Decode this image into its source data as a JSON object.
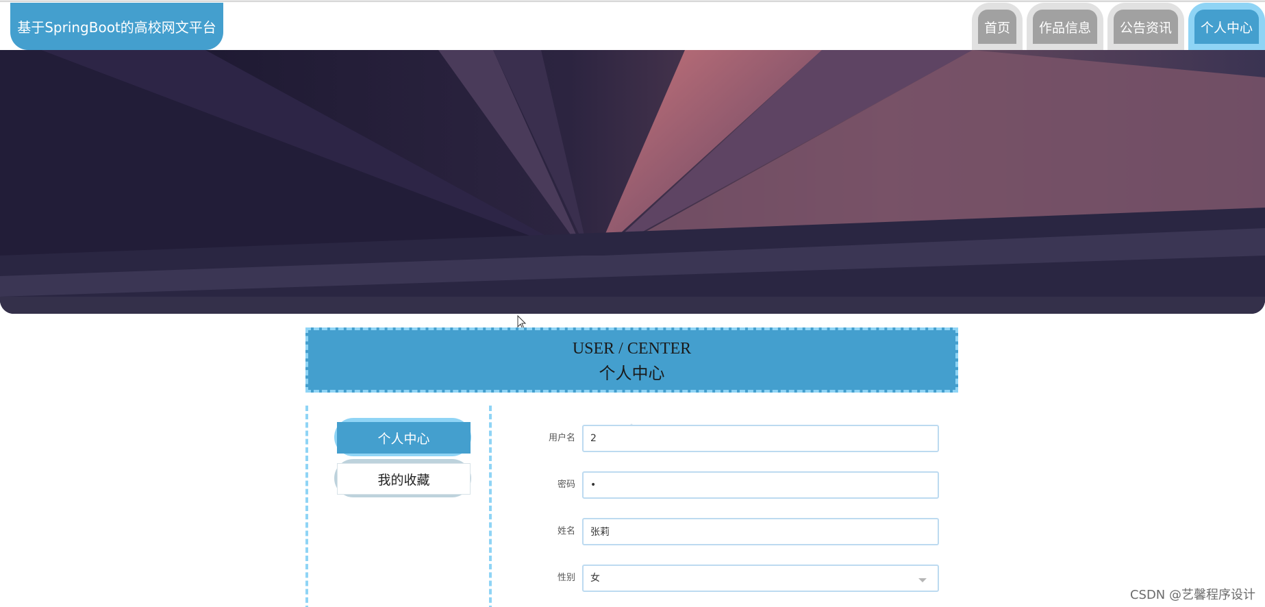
{
  "header": {
    "brand": "基于SpringBoot的高校网文平台",
    "nav": [
      {
        "label": "首页",
        "active": false
      },
      {
        "label": "作品信息",
        "active": false
      },
      {
        "label": "公告资讯",
        "active": false
      },
      {
        "label": "个人中心",
        "active": true
      }
    ]
  },
  "banner": {
    "slides": 3,
    "active_slide": 0
  },
  "section": {
    "title_en": "USER / CENTER",
    "title_cn": "个人中心"
  },
  "sidebar": {
    "items": [
      {
        "label": "个人中心",
        "active": true
      },
      {
        "label": "我的收藏",
        "active": false
      }
    ]
  },
  "form": {
    "fields": [
      {
        "label": "用户名",
        "value": "2"
      },
      {
        "label": "密码",
        "value": "•"
      },
      {
        "label": "姓名",
        "value": "张莉"
      },
      {
        "label": "性别",
        "value": "女"
      }
    ]
  },
  "watermark": "CSDN @艺馨程序设计",
  "colors": {
    "accent": "#449fce",
    "accent_light": "#8fd4f5",
    "nav_inactive": "#a1a1a1"
  }
}
